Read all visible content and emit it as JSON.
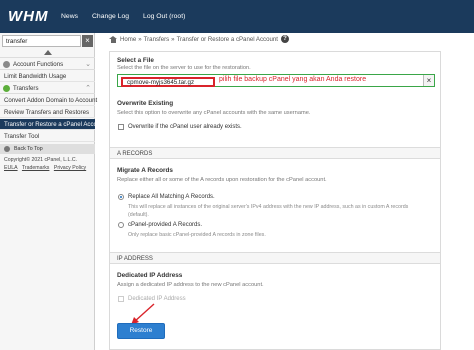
{
  "app": {
    "logo": "WHM"
  },
  "topnav": [
    "News",
    "Change Log",
    "Log Out (root)"
  ],
  "sidebar": {
    "search_value": "transfer",
    "clear_icon": "close-icon",
    "categories": [
      {
        "label": "Account Functions",
        "icon_color": "#8a8a8a"
      },
      {
        "label": "Transfers",
        "icon_color": "#5cae3b"
      }
    ],
    "account_items": [
      "Limit Bandwidth Usage"
    ],
    "transfer_items": [
      "Convert Addon Domain to Account",
      "Review Transfers and Restores",
      "Transfer or Restore a cPanel Account",
      "Transfer Tool"
    ],
    "active_item": "Transfer or Restore a cPanel Account",
    "back_to_top": "Back To Top",
    "copyright": "Copyright© 2021 cPanel, L.L.C.",
    "footer_links": [
      "EULA",
      "Trademarks",
      "Privacy Policy"
    ]
  },
  "breadcrumb": {
    "home": "Home",
    "section": "Transfers",
    "page": "Transfer or Restore a cPanel Account"
  },
  "form": {
    "select_file": {
      "title": "Select a File",
      "desc": "Select the file on the server to use for the restoration.",
      "value": "cpmove-myjs3645.tar.gz",
      "annotation": "pilih file backup cPanel yang akan Anda restore"
    },
    "overwrite": {
      "title": "Overwrite Existing",
      "desc": "Select this option to overwrite any cPanel accounts with the same username.",
      "checkbox_label": "Overwrite if the cPanel user already exists."
    },
    "a_records": {
      "header": "A RECORDS",
      "title": "Migrate A Records",
      "desc": "Replace either all or some of the A records upon restoration for the cPanel account.",
      "opt1_label": "Replace All Matching A Records.",
      "opt1_desc_1": "This will replace all instances of the original server's IPv4 address with the new IP address, such as in custom A records",
      "opt1_desc_2": "(default).",
      "opt2_label": "cPanel-provided A Records.",
      "opt2_desc": "Only replace basic cPanel-provided A records in zone files."
    },
    "ip_address": {
      "header": "IP ADDRESS",
      "title": "Dedicated IP Address",
      "desc": "Assign a dedicated IP address to the new cPanel account.",
      "checkbox_label": "Dedicated IP Address"
    },
    "restore_label": "Restore"
  },
  "colors": {
    "nav_bg": "#1b3a5c",
    "annotation_red": "#d9242b",
    "highlight_green": "#3aa648",
    "primary_blue": "#2d7fd0"
  }
}
